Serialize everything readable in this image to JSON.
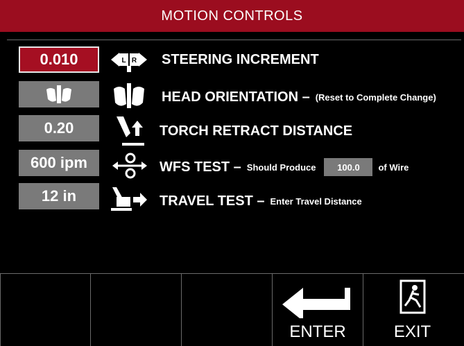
{
  "title": "MOTION CONTROLS",
  "rows": [
    {
      "value": "0.010",
      "label": "STEERING INCREMENT",
      "icon": "steering-lr-icon"
    },
    {
      "value": "",
      "label": "HEAD ORIENTATION –",
      "note": "(Reset to Complete Change)",
      "icon": "head-orientation-icon"
    },
    {
      "value": "0.20",
      "label": "TORCH RETRACT DISTANCE",
      "icon": "torch-retract-icon"
    },
    {
      "value": "600 ipm",
      "label": "WFS TEST –",
      "note": "Should Produce",
      "wire_value": "100.0",
      "wire_suffix": "of Wire",
      "icon": "wire-feed-icon"
    },
    {
      "value": "12 in",
      "label": "TRAVEL TEST –",
      "note": "Enter Travel Distance",
      "icon": "travel-icon"
    }
  ],
  "bottom": {
    "enter_label": "ENTER",
    "exit_label": "EXIT"
  },
  "colors": {
    "accent": "#9b0d1f",
    "box_gray": "#7a7a7a"
  }
}
